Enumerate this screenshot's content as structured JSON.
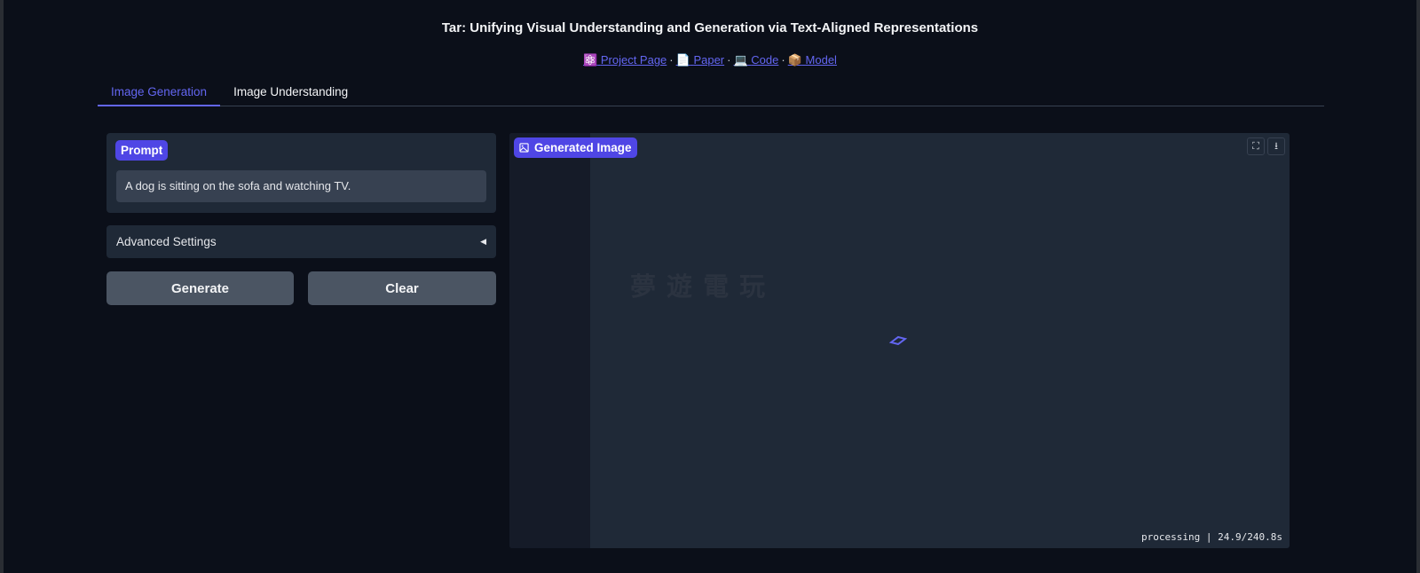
{
  "header": {
    "title": "Tar: Unifying Visual Understanding and Generation via Text-Aligned Representations",
    "links": [
      {
        "emoji": "⚛️",
        "label": "Project Page"
      },
      {
        "emoji": "📄",
        "label": "Paper"
      },
      {
        "emoji": "💻",
        "label": "Code"
      },
      {
        "emoji": "📦",
        "label": "Model"
      }
    ],
    "separator": "·"
  },
  "tabs": [
    {
      "label": "Image Generation",
      "active": true
    },
    {
      "label": "Image Understanding",
      "active": false
    }
  ],
  "prompt": {
    "label": "Prompt",
    "value": "A dog is sitting on the sofa and watching TV."
  },
  "advanced": {
    "label": "Advanced Settings",
    "arrow": "◀"
  },
  "buttons": {
    "generate": "Generate",
    "clear": "Clear"
  },
  "output": {
    "label": "Generated Image",
    "status": "processing | 24.9/240.8s",
    "progress": 0.103,
    "watermark": "夢 遊 電 玩"
  },
  "colors": {
    "accent": "#4f46e5",
    "bg": "#0b0f19",
    "panel": "#1f2937"
  }
}
